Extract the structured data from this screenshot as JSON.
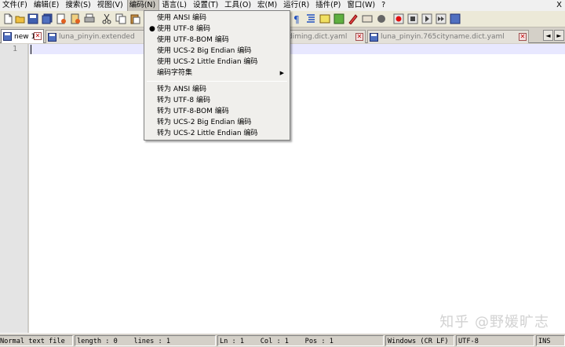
{
  "menubar": {
    "items": [
      "文件(F)",
      "编辑(E)",
      "搜索(S)",
      "视图(V)",
      "编码(N)",
      "语言(L)",
      "设置(T)",
      "工具(O)",
      "宏(M)",
      "运行(R)",
      "插件(P)",
      "窗口(W)",
      "?"
    ],
    "close": "X"
  },
  "tabs": [
    {
      "label": "new 1"
    },
    {
      "label": "luna_pinyin.extended"
    },
    {
      "label": "diming.dict.yaml"
    },
    {
      "label": "luna_pinyin.765cityname.dict.yaml"
    }
  ],
  "tab_scroll": {
    "left": "◄",
    "right": "►"
  },
  "encoding_menu": {
    "group1": [
      "使用 ANSI 编码",
      "使用 UTF-8 编码",
      "使用 UTF-8-BOM 编码",
      "使用 UCS-2 Big Endian 编码",
      "使用 UCS-2 Little Endian 编码",
      "编码字符集"
    ],
    "group2": [
      "转为 ANSI 编码",
      "转为 UTF-8 编码",
      "转为 UTF-8-BOM 编码",
      "转为 UCS-2 Big Endian 编码",
      "转为 UCS-2 Little Endian 编码"
    ],
    "checked_bullet": "●",
    "submenu_arrow": "▶"
  },
  "editor": {
    "line_number": "1",
    "watermark": "知乎 @野媛旷志"
  },
  "statusbar": {
    "type": "Normal text file",
    "length": "length : 0",
    "lines": "lines : 1",
    "ln": "Ln : 1",
    "col": "Col : 1",
    "pos": "Pos : 1",
    "eol": "Windows (CR LF)",
    "encoding": "UTF-8",
    "mode": "INS"
  },
  "colors": {
    "current_line": "#e8e8ff",
    "tab_close": "#c00000",
    "toolbar_bg": "#ece9d8"
  }
}
